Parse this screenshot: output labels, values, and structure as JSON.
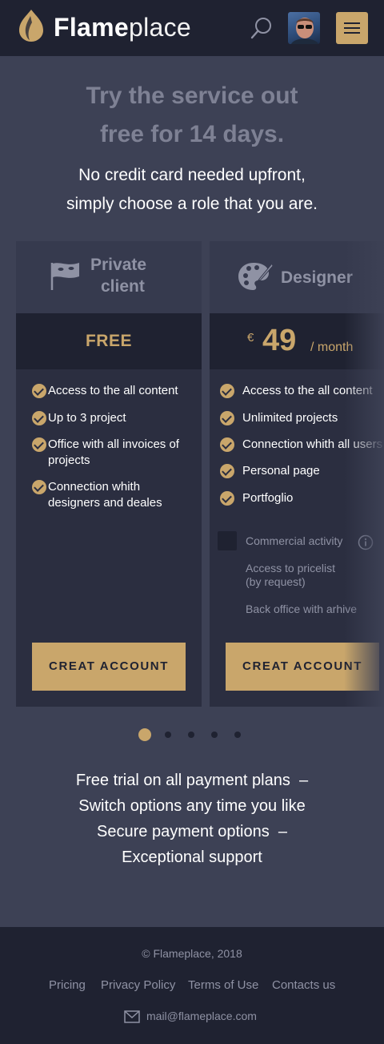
{
  "header": {
    "brand_bold": "Flame",
    "brand_light": "place",
    "icons": {
      "logo": "flame-logo-icon",
      "search": "search-icon",
      "menu": "hamburger-menu-icon"
    },
    "accent_color": "#c9a66b"
  },
  "hero": {
    "title_line1": "Try the service out",
    "title_line2": "free for 14 days.",
    "sub_line1": "No credit card needed upfront,",
    "sub_line2": "simply choose a role that you are."
  },
  "plans": [
    {
      "icon": "mask-flag-icon",
      "title_line1": "Private",
      "title_line2": "client",
      "price": "FREE",
      "features": [
        "Access to the all content",
        "Up to 3 project",
        "Office with all invoices of",
        "projects",
        "Connection whith",
        "designers and deales"
      ],
      "button": "CREAT ACCOUNT"
    },
    {
      "icon": "palette-icon",
      "title": "Designer",
      "currency": "€",
      "price": "49",
      "period": "/ month",
      "features": [
        "Access to the all content",
        "Unlimited projects",
        "Connection whith all users",
        "Personal page",
        "Portfoglio"
      ],
      "option_label": "Commercial activity",
      "option_icon": "info-icon",
      "option_checked": false,
      "option_sub1": "Access to pricelist",
      "option_sub1b": "(by request)",
      "option_sub2": "Back office with arhive",
      "button": "CREAT ACCOUNT"
    }
  ],
  "carousel": {
    "total": 5,
    "active_index": 1
  },
  "benefits": {
    "line1": "Free trial on all payment plans",
    "line2": "Switch options any time you like",
    "line3": "Secure payment options",
    "line4": "Exceptional support",
    "sep": "–"
  },
  "footer": {
    "copyright": "© Flameplace, 2018",
    "links": [
      "Pricing",
      "Privacy Policy",
      "Terms of Use",
      "Contacts us"
    ],
    "email": "mail@flameplace.com",
    "email_icon": "envelope-icon"
  }
}
